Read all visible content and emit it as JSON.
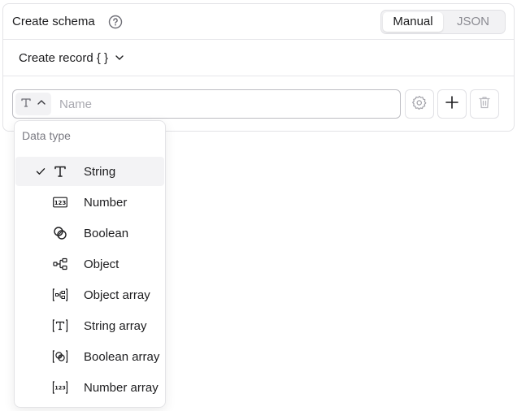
{
  "header": {
    "title": "Create schema",
    "mode_options": [
      {
        "label": "Manual",
        "active": true
      },
      {
        "label": "JSON",
        "active": false
      }
    ]
  },
  "record": {
    "label": "Create record { }"
  },
  "field": {
    "name_placeholder": "Name"
  },
  "dropdown": {
    "label": "Data type",
    "items": [
      {
        "label": "String",
        "icon": "string-type-icon",
        "selected": true
      },
      {
        "label": "Number",
        "icon": "number-type-icon",
        "selected": false
      },
      {
        "label": "Boolean",
        "icon": "boolean-type-icon",
        "selected": false
      },
      {
        "label": "Object",
        "icon": "object-type-icon",
        "selected": false
      },
      {
        "label": "Object array",
        "icon": "object-array-type-icon",
        "selected": false
      },
      {
        "label": "String array",
        "icon": "string-array-type-icon",
        "selected": false
      },
      {
        "label": "Boolean array",
        "icon": "boolean-array-type-icon",
        "selected": false
      },
      {
        "label": "Number array",
        "icon": "number-array-type-icon",
        "selected": false
      }
    ]
  },
  "colors": {
    "text": "#1c1c1e",
    "muted": "#7a7a82",
    "border": "#e3e3e6",
    "selected_bg": "#f3f3f5"
  }
}
